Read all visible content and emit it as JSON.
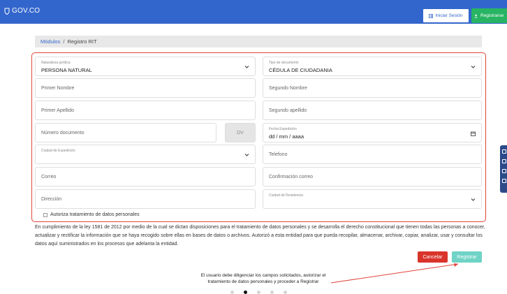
{
  "header": {
    "logo_text": "GOV.CO",
    "login_label": "Iniciar Sesión",
    "register_label": "Registrarse"
  },
  "breadcrumb": {
    "parent": "Módulos",
    "separator": "/",
    "current": "Registro RIT"
  },
  "form": {
    "naturaleza": {
      "label": "Naturaleza jurídica",
      "value": "PERSONA NATURAL"
    },
    "tipo_documento": {
      "label": "Tipo de documento",
      "value": "CÉDULA DE CIUDADANIA"
    },
    "primer_nombre": {
      "placeholder": "Primer Nombre"
    },
    "segundo_nombre": {
      "placeholder": "Segundo Nombre"
    },
    "primer_apellido": {
      "placeholder": "Primer Apellido"
    },
    "segundo_apellido": {
      "placeholder": "Segundo apellido"
    },
    "numero_documento": {
      "placeholder": "Número documento"
    },
    "dv": {
      "placeholder": "DV"
    },
    "fecha_expedicion": {
      "label": "Fecha Expedición",
      "value": "dd / mm / aaaa"
    },
    "ciudad_expedicion": {
      "label": "Ciudad de Expedición"
    },
    "telefono": {
      "placeholder": "Telefono"
    },
    "correo": {
      "placeholder": "Correo"
    },
    "confirmacion_correo": {
      "placeholder": "Confirmación correo"
    },
    "direccion": {
      "placeholder": "Dirección"
    },
    "ciudad_residencia": {
      "label": "Ciudad de Residencia"
    },
    "autoriza_label": "Autoriza tratamiento de datos personales"
  },
  "legal_text": "En cumplimiento de la ley 1581 de 2012 por medio de la cual se dictan disposiciones para el tratamiento de datos personales y se desarrolla el derecho constitucional que tienen todas las personas a conocer, actualizar y rectificar la información que se haya recogido sobre ellas en bases de datos o archivos. Autorizó a esta entidad para que pueda recopilar, almacenar, archivar, copiar, analizar, usar y consultar los datos aquí suministrados en los procesos que adelanta la entidad.",
  "actions": {
    "cancel_label": "Cancelar",
    "submit_label": "Registrar"
  },
  "annotation": {
    "line1": "El usuario debe diligenciar los campos solicitados, autorizar el",
    "line2": "tratamiento de datos personales y proceder a Registrar"
  },
  "colors": {
    "header_bg": "#3366cc",
    "highlight_frame": "#e0453a",
    "cancel": "#d9342b",
    "submit": "#6fd3c6",
    "register_top": "#28b463"
  }
}
